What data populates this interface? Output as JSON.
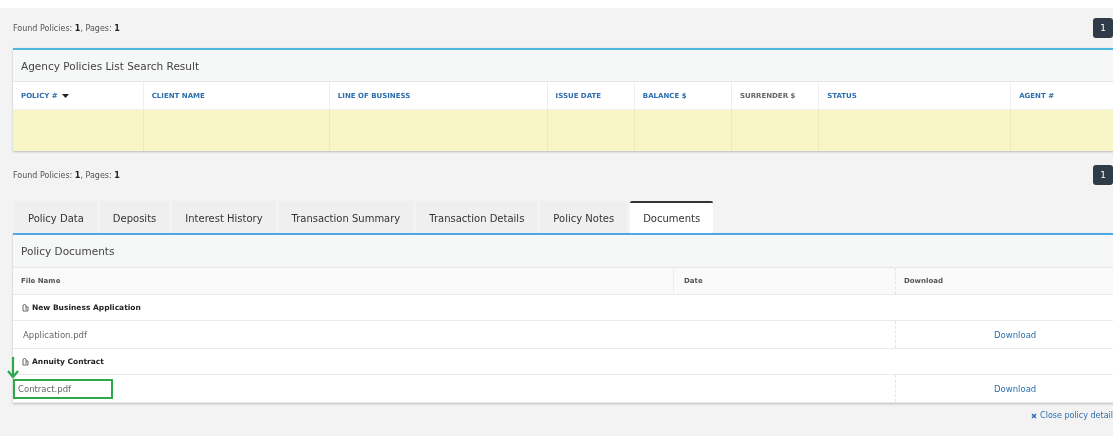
{
  "search_summary": {
    "label": "Found Policies: ",
    "policies": "1",
    "pages_label": ", Pages: ",
    "pages": "1"
  },
  "pager_top": {
    "pages": [
      "1"
    ]
  },
  "search_panel": {
    "title": "Agency Policies List Search Result",
    "columns": [
      {
        "label": "POLICY #",
        "kind": "sorted"
      },
      {
        "label": "CLIENT NAME",
        "kind": "sortable"
      },
      {
        "label": "LINE OF BUSINESS",
        "kind": "sortable"
      },
      {
        "label": "ISSUE DATE",
        "kind": "sortable"
      },
      {
        "label": "BALANCE $",
        "kind": "sortable"
      },
      {
        "label": "SURRENDER $",
        "kind": "plain"
      },
      {
        "label": "STATUS",
        "kind": "sortable"
      },
      {
        "label": "AGENT #",
        "kind": "sortable"
      }
    ],
    "rows": [
      {
        "selected": true
      }
    ]
  },
  "detail_summary": {
    "label": "Found Policies: ",
    "policies": "1",
    "pages_label": ", Pages: ",
    "pages": "1"
  },
  "pager_bottom": {
    "pages": [
      "1"
    ]
  },
  "tabs": [
    {
      "label": "Policy Data",
      "selected": false
    },
    {
      "label": "Deposits",
      "selected": false
    },
    {
      "label": "Interest History",
      "selected": false
    },
    {
      "label": "Transaction Summary",
      "selected": false
    },
    {
      "label": "Transaction Details",
      "selected": false
    },
    {
      "label": "Policy Notes",
      "selected": false
    },
    {
      "label": "Documents",
      "selected": true
    }
  ],
  "documents": {
    "title": "Policy Documents",
    "columns": [
      "File Name",
      "Date",
      "Download"
    ],
    "rows": [
      {
        "kind": "group",
        "name": "New Business Application"
      },
      {
        "kind": "file",
        "name": "Application.pdf",
        "download": "Download",
        "highlighted": false
      },
      {
        "kind": "group",
        "name": "Annuity Contract"
      },
      {
        "kind": "file",
        "name": "Contract.pdf",
        "download": "Download",
        "highlighted": true
      }
    ]
  },
  "close_link": "Close policy detail"
}
